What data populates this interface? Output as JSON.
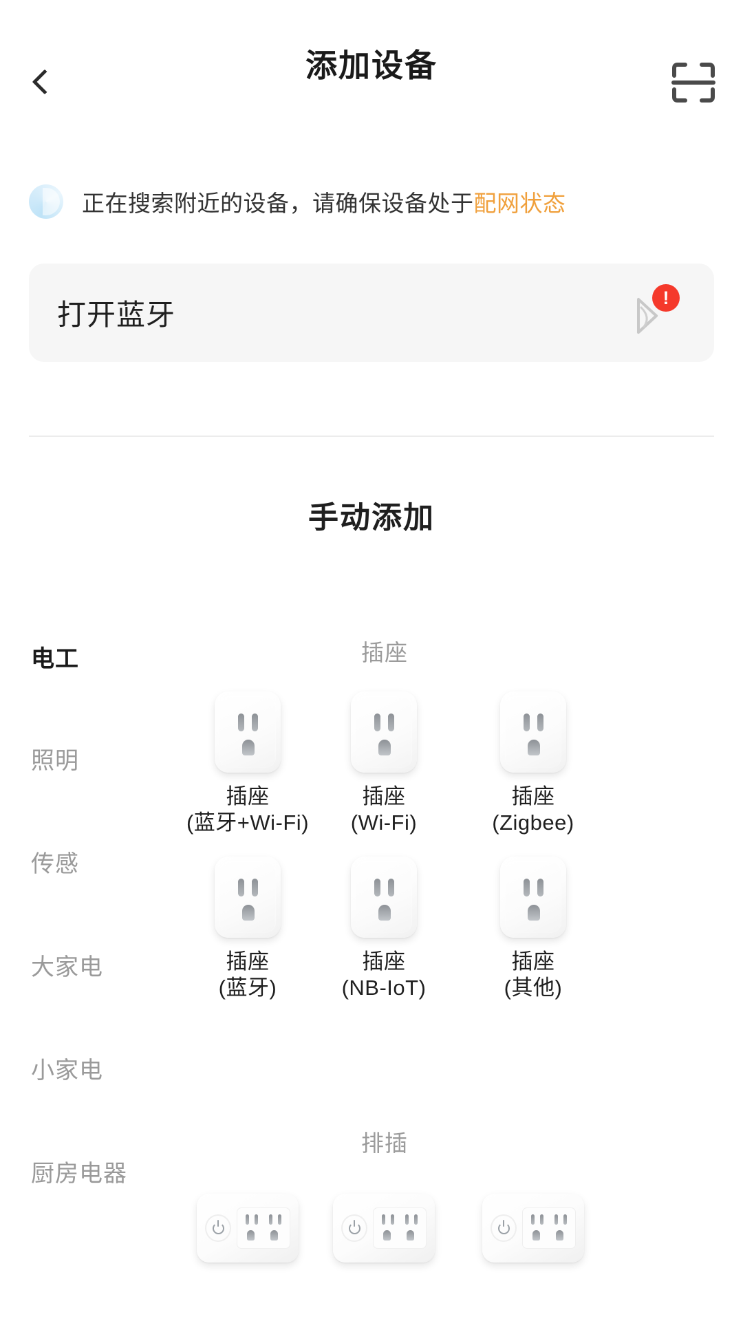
{
  "header": {
    "title": "添加设备",
    "back_icon": "chevron-left-icon",
    "scan_icon": "scan-code-icon"
  },
  "status": {
    "icon": "loading-spinner-icon",
    "text_plain": "正在搜索附近的设备，请确保设备处于",
    "text_highlight": "配网状态",
    "highlight_color": "#f0a03c"
  },
  "bluetooth_card": {
    "label": "打开蓝牙",
    "icon": "bluetooth-icon",
    "badge": "!",
    "badge_color": "#f5392b",
    "background": "#f6f6f6"
  },
  "manual": {
    "title": "手动添加"
  },
  "sidebar": {
    "items": [
      {
        "label": "电工",
        "active": true
      },
      {
        "label": "照明",
        "active": false
      },
      {
        "label": "传感",
        "active": false
      },
      {
        "label": "大家电",
        "active": false
      },
      {
        "label": "小家电",
        "active": false
      },
      {
        "label": "厨房电器",
        "active": false
      }
    ]
  },
  "sections": [
    {
      "title": "插座",
      "products": [
        {
          "name": "插座",
          "variant": "(蓝牙+Wi-Fi)",
          "icon": "socket-icon"
        },
        {
          "name": "插座",
          "variant": "(Wi-Fi)",
          "icon": "socket-icon"
        },
        {
          "name": "插座",
          "variant": "(Zigbee)",
          "icon": "socket-icon"
        },
        {
          "name": "插座",
          "variant": "(蓝牙)",
          "icon": "socket-icon"
        },
        {
          "name": "插座",
          "variant": "(NB-IoT)",
          "icon": "socket-icon"
        },
        {
          "name": "插座",
          "variant": "(其他)",
          "icon": "socket-icon"
        }
      ]
    },
    {
      "title": "排插",
      "products": [
        {
          "name": "",
          "variant": "",
          "icon": "power-strip-icon"
        },
        {
          "name": "",
          "variant": "",
          "icon": "power-strip-icon"
        },
        {
          "name": "",
          "variant": "",
          "icon": "power-strip-icon"
        }
      ]
    }
  ]
}
